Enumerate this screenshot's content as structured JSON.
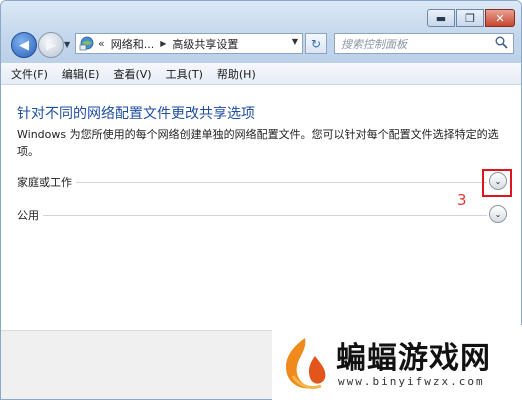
{
  "window": {
    "controls": {
      "minimize": "▬",
      "maximize": "❐",
      "close": "✕"
    }
  },
  "nav": {
    "back_icon": "◀",
    "forward_icon": "▶",
    "history_dropdown": "▼"
  },
  "address": {
    "chevron": "«",
    "segments": [
      "网络和...",
      "高级共享设置"
    ],
    "separator": "▶",
    "dropdown": "▼"
  },
  "refresh_icon": "↻",
  "search": {
    "placeholder": "搜索控制面板"
  },
  "menu": {
    "items": [
      "文件(F)",
      "编辑(E)",
      "查看(V)",
      "工具(T)",
      "帮助(H)"
    ]
  },
  "main": {
    "heading": "针对不同的网络配置文件更改共享选项",
    "description": "Windows 为您所使用的每个网络创建单独的网络配置文件。您可以针对每个配置文件选择特定的选项。",
    "profiles": [
      {
        "label": "家庭或工作",
        "expander": "⌄"
      },
      {
        "label": "公用",
        "expander": "⌄"
      }
    ],
    "annotation": "3"
  },
  "watermark": {
    "title": "蝙蝠游戏网",
    "url": "www.binyifwzx.com"
  },
  "colors": {
    "heading": "#1f4fa0",
    "highlight": "#e0151c",
    "annotation": "#e03a32",
    "logo_orange": "#f08a1c"
  }
}
